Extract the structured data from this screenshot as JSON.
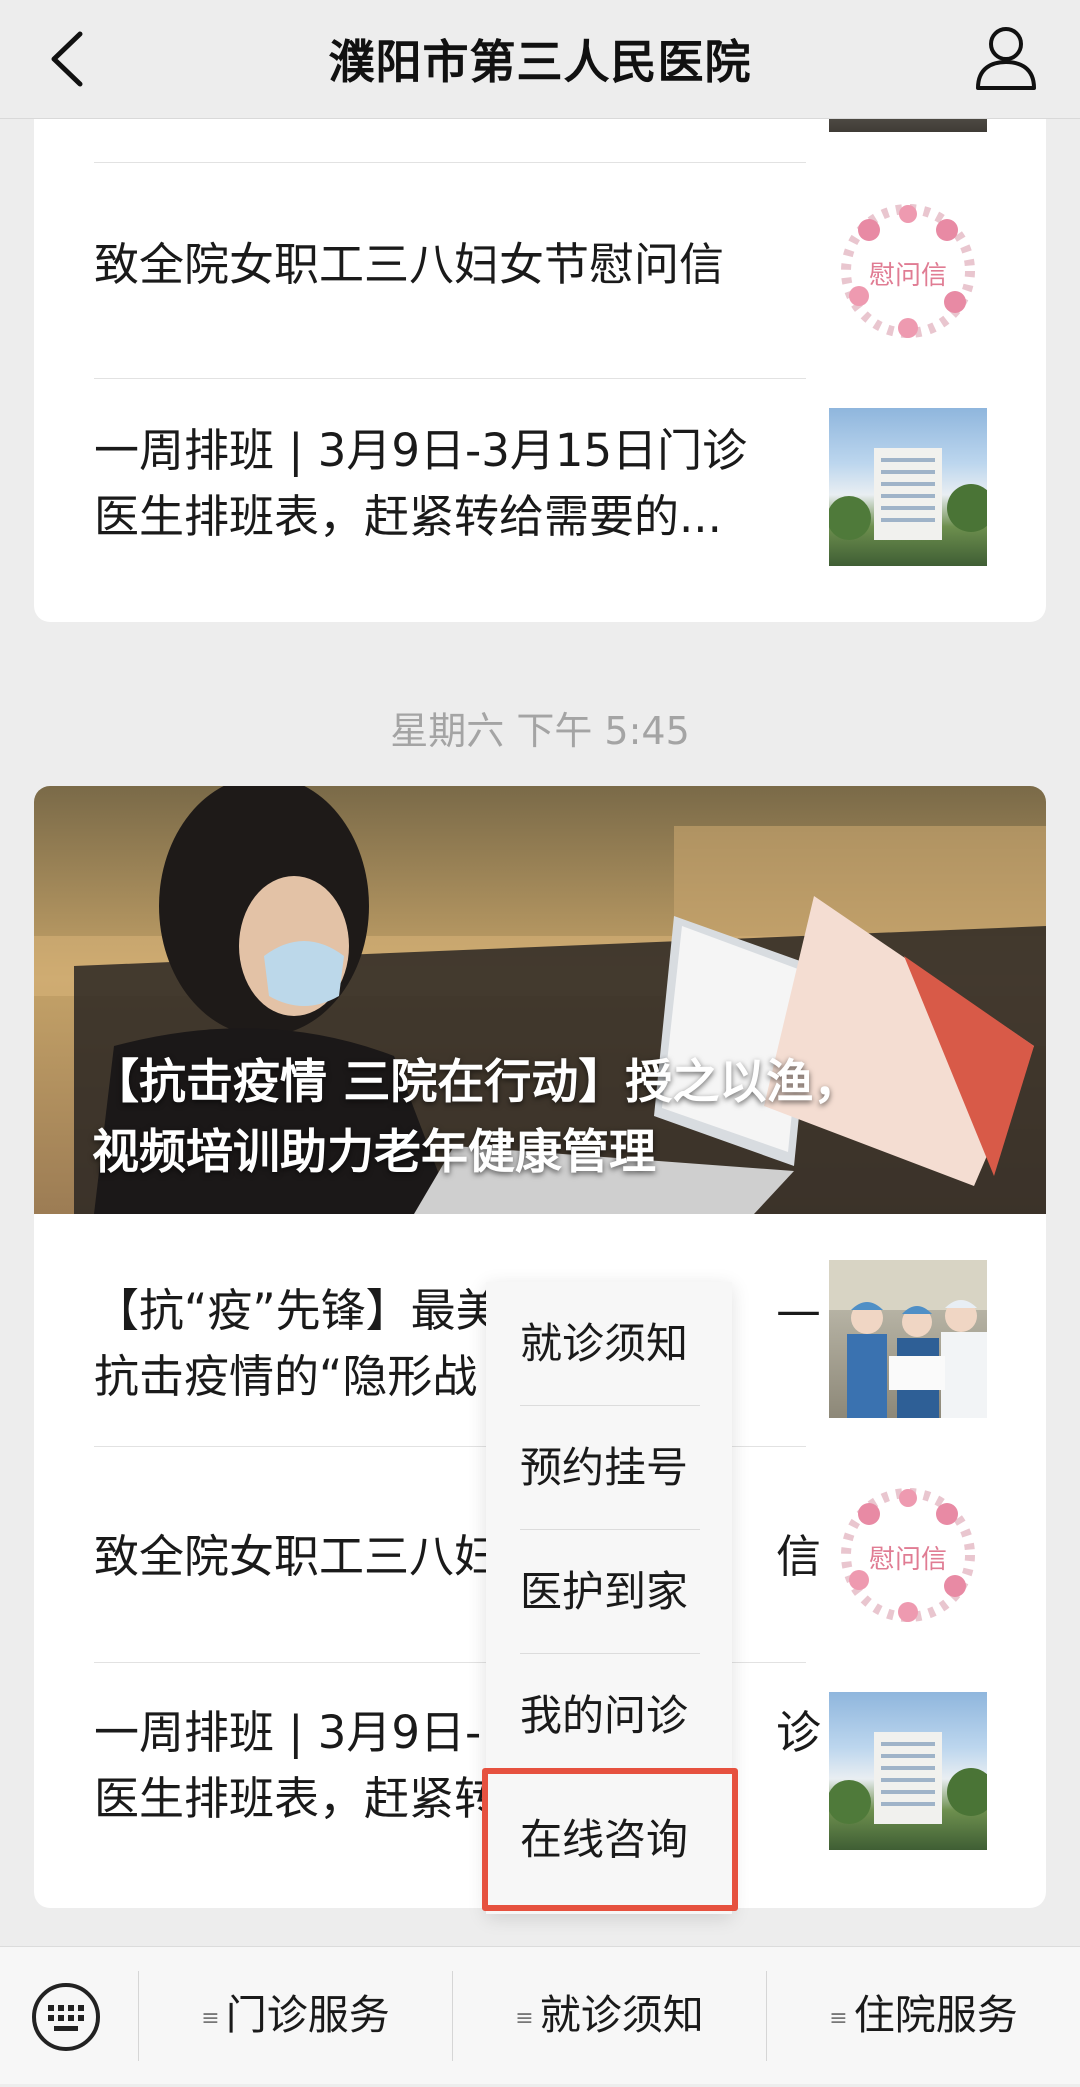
{
  "header": {
    "title": "濮阳市第三人民医院",
    "back_icon": "chevron-left-icon",
    "profile_icon": "user-icon"
  },
  "top_card": {
    "items": [
      {
        "title": "致全院女职工三八妇女节慰问信",
        "thumb_text": "慰问信"
      },
      {
        "title_line1": "一周排班 | 3月9日-3月15日门诊",
        "title_line2": "医生排班表，赶紧转给需要的..."
      }
    ]
  },
  "timestamp": "星期六 下午 5:45",
  "bottom_card": {
    "hero_title_line1": "【抗击疫情 三院在行动】授之以渔，",
    "hero_title_line2": "视频培训助力老年健康管理",
    "items": [
      {
        "title_line1": "【抗“疫”先锋】最美",
        "title_line1_tail": "—",
        "title_line2": "抗击疫情的“隐形战"
      },
      {
        "title": "致全院女职工三八妇",
        "title_tail": "信",
        "thumb_text": "慰问信"
      },
      {
        "title_line1": "一周排班 | 3月9日-",
        "title_line1_tail": "诊",
        "title_line2": "医生排班表，赶紧转"
      }
    ]
  },
  "popup_menu": {
    "items": [
      "就诊须知",
      "预约挂号",
      "医护到家",
      "我的问诊",
      "在线咨询"
    ],
    "highlighted": "在线咨询",
    "highlight_color": "#e6513f"
  },
  "bottom_bar": {
    "keyboard_icon": "keyboard-icon",
    "tabs": [
      "门诊服务",
      "就诊须知",
      "住院服务"
    ]
  }
}
